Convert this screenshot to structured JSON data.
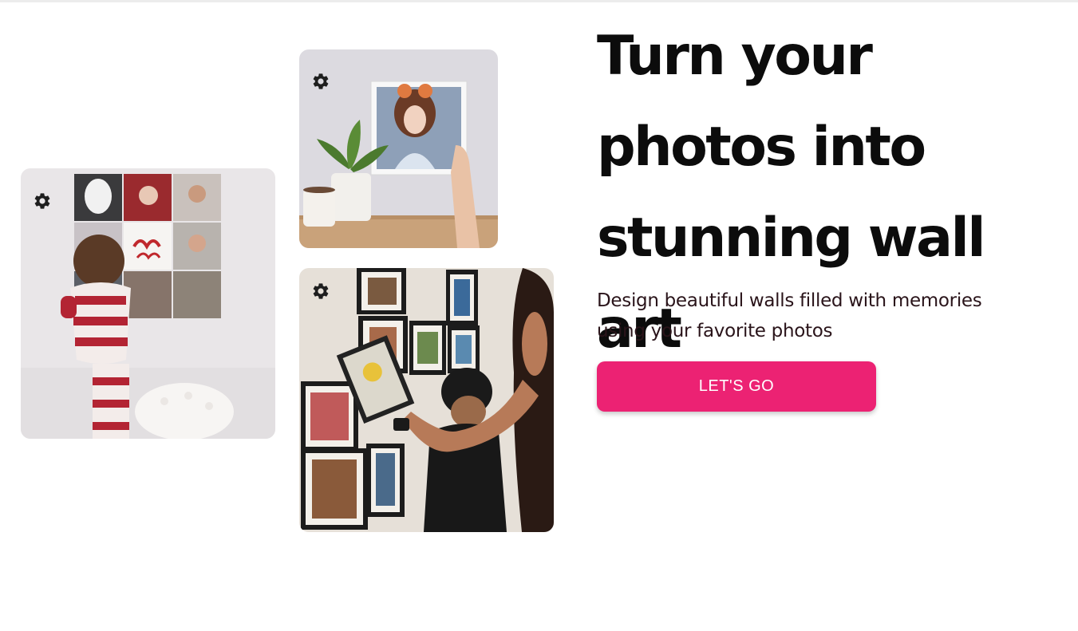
{
  "hero": {
    "title": "Turn your photos into stunning wall art",
    "subtitle": "Design beautiful walls filled with memories using your favorite photos",
    "cta_label": "LET'S GO"
  },
  "colors": {
    "accent": "#ec2273",
    "heading": "#0c0c0c",
    "body_text": "#2a141a",
    "background": "#ffffff"
  },
  "gallery": {
    "items": [
      {
        "name": "child-hanging-photo-grid",
        "icon": "gear-icon"
      },
      {
        "name": "framed-portrait-on-shelf",
        "icon": "gear-icon"
      },
      {
        "name": "family-hanging-frames",
        "icon": "gear-icon"
      }
    ]
  }
}
